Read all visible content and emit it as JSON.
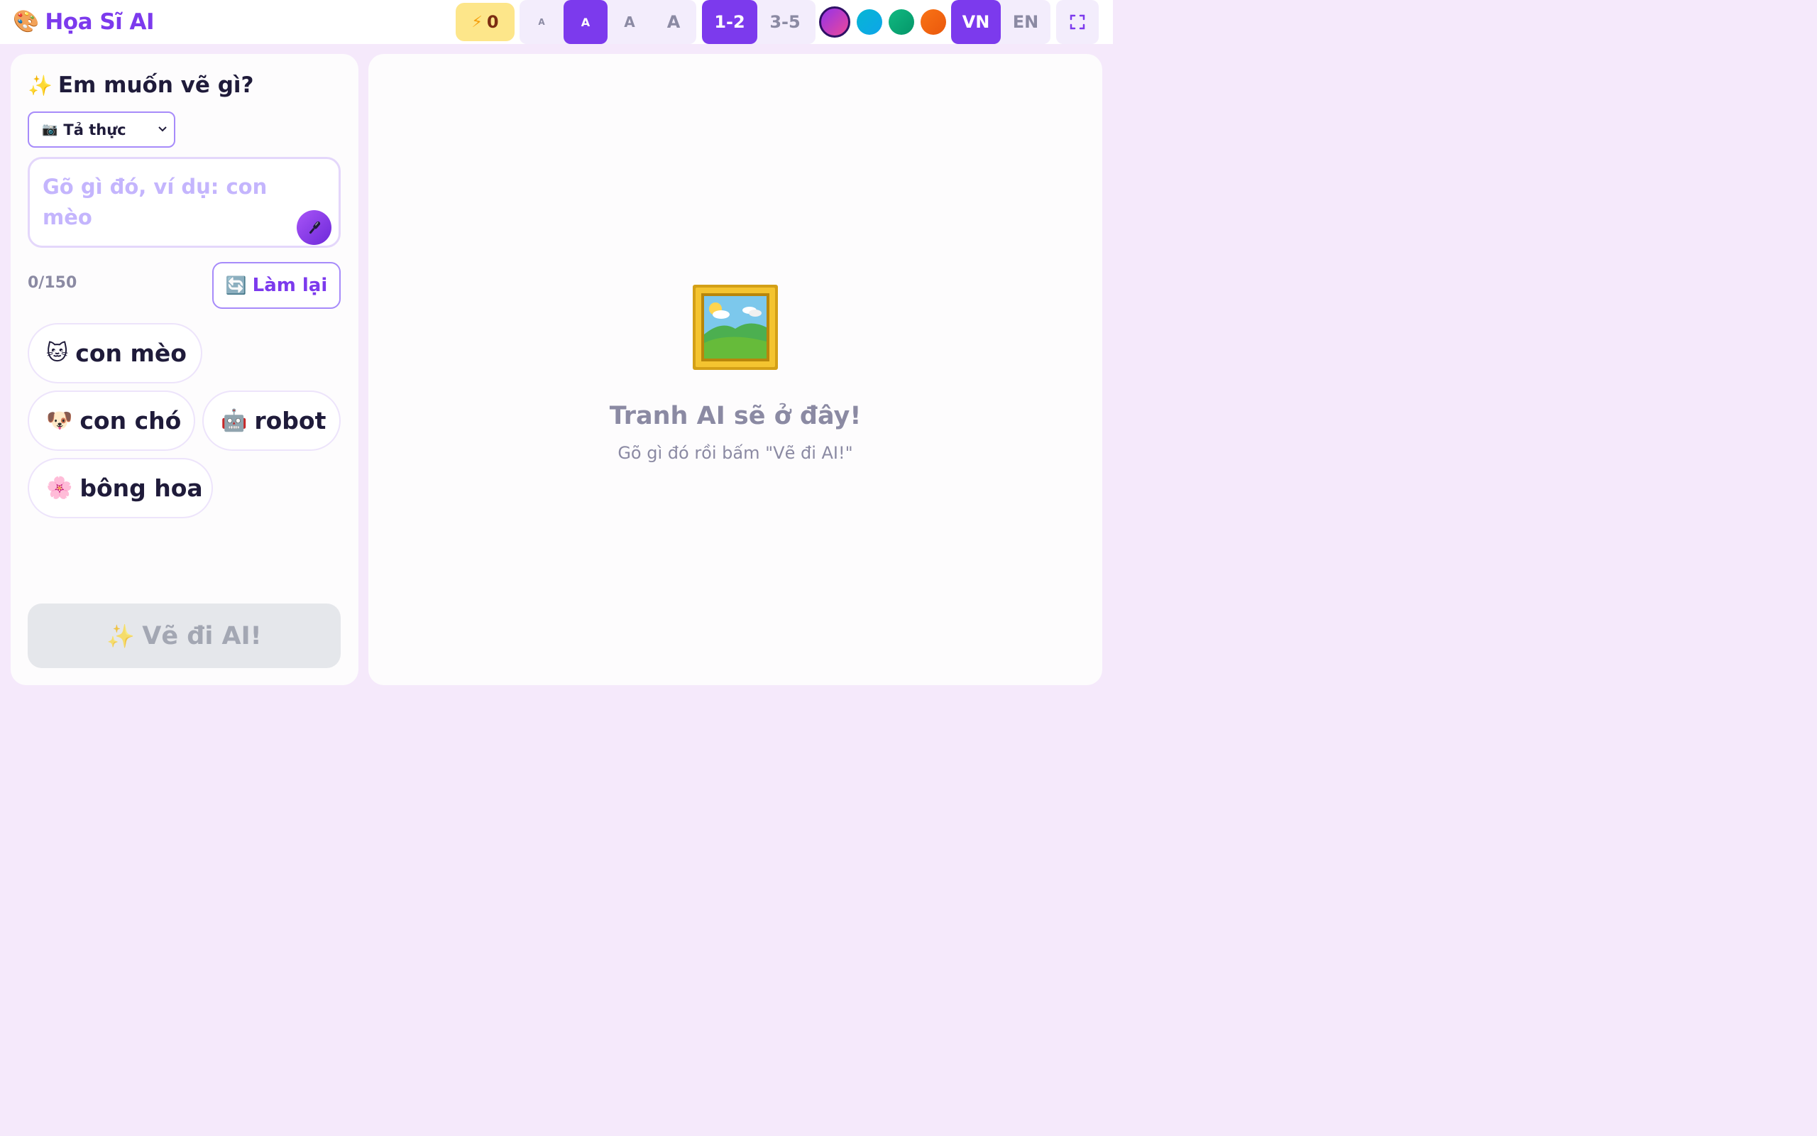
{
  "app": {
    "icon": "palette-icon",
    "title": "Họa Sĩ AI"
  },
  "topbar": {
    "energy": {
      "icon": "lightning-icon",
      "count": "0"
    },
    "font_sizes": [
      {
        "label": "A",
        "active": false
      },
      {
        "label": "A",
        "active": true
      },
      {
        "label": "A",
        "active": false
      },
      {
        "label": "A",
        "active": false
      }
    ],
    "age_groups": [
      {
        "label": "1-2",
        "active": true
      },
      {
        "label": "3-5",
        "active": false
      }
    ],
    "theme_colors": [
      "#a855f7",
      "#06b6d4",
      "#10b981",
      "#f97316"
    ],
    "selected_theme": 0,
    "languages": [
      {
        "label": "VN",
        "active": true
      },
      {
        "label": "EN",
        "active": false
      }
    ],
    "fullscreen_icon": "fullscreen-icon"
  },
  "left": {
    "heading_icon": "✨",
    "heading": "Em muốn vẽ gì?",
    "style_select": {
      "icon": "📷",
      "value": "Tả thực"
    },
    "prompt": {
      "value": "",
      "placeholder": "Gõ gì đó, ví dụ: con mèo",
      "mic_icon": "microphone-icon"
    },
    "char_count": "0/150",
    "reset": {
      "icon": "🔄",
      "label": "Làm lại"
    },
    "suggestions": [
      {
        "icon": "🐱",
        "label": "con mèo"
      },
      {
        "icon": "🐶",
        "label": "con chó"
      },
      {
        "icon": "🤖",
        "label": "robot"
      },
      {
        "icon": "🌸",
        "label": "bông hoa"
      }
    ],
    "draw_button": {
      "icon": "✨",
      "label": "Vẽ đi AI!"
    }
  },
  "right": {
    "placeholder_icon": "framed-picture-icon",
    "title": "Tranh AI sẽ ở đây!",
    "subtitle": "Gõ gì đó rồi bấm \"Vẽ đi AI!\""
  }
}
